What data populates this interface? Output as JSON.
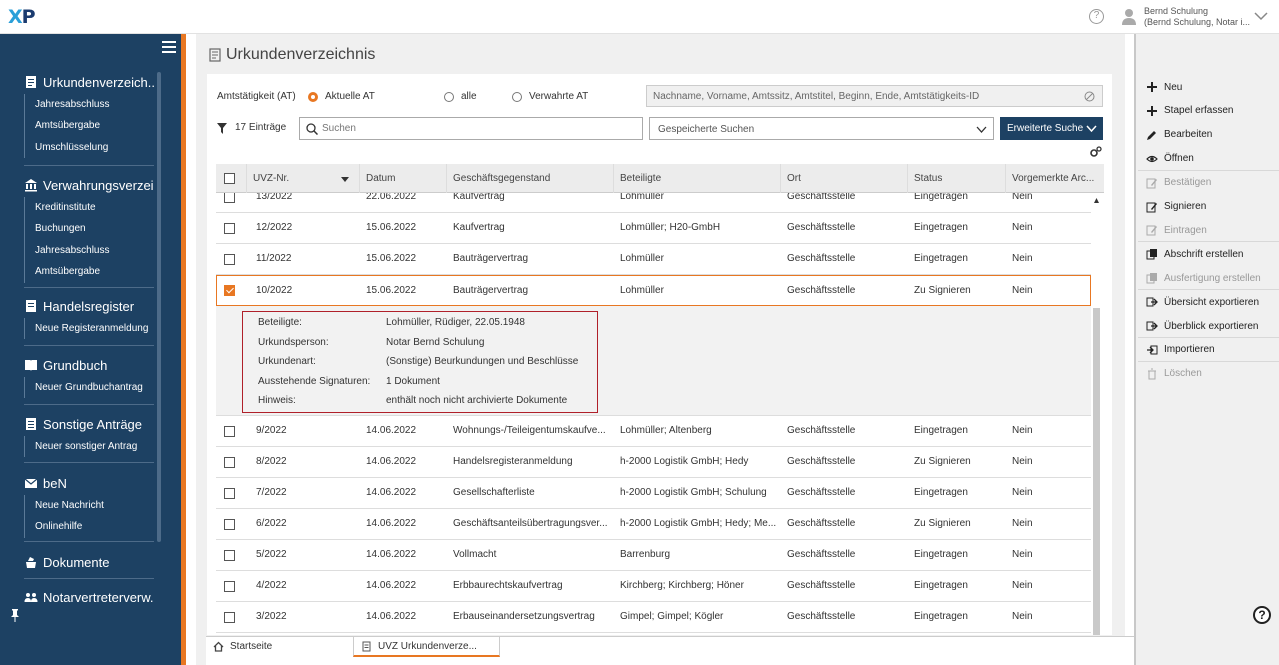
{
  "app": {
    "logo": "XP",
    "help_label": "?"
  },
  "user": {
    "name": "Bernd Schulung",
    "role": "(Bernd Schulung, Notar i..."
  },
  "sidebar": {
    "sections": [
      {
        "title": "Urkundenverzeich...",
        "icon": "document-icon",
        "items": [
          "Jahresabschluss",
          "Amtsübergabe",
          "Umschlüsselung"
        ]
      },
      {
        "title": "Verwahrungsverzei...",
        "icon": "bank-icon",
        "items": [
          "Kreditinstitute",
          "Buchungen",
          "Jahresabschluss",
          "Amtsübergabe"
        ]
      },
      {
        "title": "Handelsregister",
        "icon": "register-icon",
        "items": [
          "Neue Registeranmeldung"
        ]
      },
      {
        "title": "Grundbuch",
        "icon": "book-icon",
        "items": [
          "Neuer Grundbuchantrag"
        ]
      },
      {
        "title": "Sonstige Anträge",
        "icon": "list-icon",
        "items": [
          "Neuer sonstiger Antrag"
        ]
      },
      {
        "title": "beN",
        "icon": "envelope-icon",
        "items": [
          "Neue Nachricht",
          "Onlinehilfe"
        ]
      },
      {
        "title": "Dokumente",
        "icon": "documents-icon",
        "items": []
      },
      {
        "title": "Notarvertreterverw...",
        "icon": "people-icon",
        "items": []
      }
    ]
  },
  "page": {
    "title": "Urkundenverzeichnis",
    "at_label": "Amtstätigkeit (AT)",
    "at_options": [
      "Aktuelle AT",
      "alle",
      "Verwahrte AT"
    ],
    "at_selected": "Aktuelle AT",
    "at_search_placeholder": "Nachname, Vorname, Amtssitz, Amtstitel, Beginn, Ende, Amtstätigkeits-ID",
    "count": "17 Einträge",
    "search_placeholder": "Suchen",
    "saved_searches": "Gespeicherte Suchen",
    "advanced_search": "Erweiterte Suche"
  },
  "table": {
    "columns": [
      "UVZ-Nr.",
      "Datum",
      "Geschäftsgegenstand",
      "Beteiligte",
      "Ort",
      "Status",
      "Vorgemerkte Arc..."
    ],
    "rows": [
      {
        "nr": "13/2022",
        "datum": "22.06.2022",
        "gegenstand": "Kaufvertrag",
        "beteiligte": "Lohmüller",
        "ort": "Geschäftsstelle",
        "status": "Eingetragen",
        "arch": "Nein",
        "checked": false
      },
      {
        "nr": "12/2022",
        "datum": "15.06.2022",
        "gegenstand": "Kaufvertrag",
        "beteiligte": "Lohmüller; H20-GmbH",
        "ort": "Geschäftsstelle",
        "status": "Eingetragen",
        "arch": "Nein",
        "checked": false
      },
      {
        "nr": "11/2022",
        "datum": "15.06.2022",
        "gegenstand": "Bauträgervertrag",
        "beteiligte": "Lohmüller",
        "ort": "Geschäftsstelle",
        "status": "Eingetragen",
        "arch": "Nein",
        "checked": false
      },
      {
        "nr": "10/2022",
        "datum": "15.06.2022",
        "gegenstand": "Bauträgervertrag",
        "beteiligte": "Lohmüller",
        "ort": "Geschäftsstelle",
        "status": "Zu Signieren",
        "arch": "Nein",
        "checked": true
      },
      {
        "nr": "9/2022",
        "datum": "14.06.2022",
        "gegenstand": "Wohnungs-/Teileigentumskaufve...",
        "beteiligte": "Lohmüller; Altenberg",
        "ort": "Geschäftsstelle",
        "status": "Eingetragen",
        "arch": "Nein",
        "checked": false
      },
      {
        "nr": "8/2022",
        "datum": "14.06.2022",
        "gegenstand": "Handelsregisteranmeldung",
        "beteiligte": "h-2000 Logistik GmbH; Hedy",
        "ort": "Geschäftsstelle",
        "status": "Zu Signieren",
        "arch": "Nein",
        "checked": false
      },
      {
        "nr": "7/2022",
        "datum": "14.06.2022",
        "gegenstand": "Gesellschafterliste",
        "beteiligte": "h-2000 Logistik GmbH; Schulung",
        "ort": "Geschäftsstelle",
        "status": "Eingetragen",
        "arch": "Nein",
        "checked": false
      },
      {
        "nr": "6/2022",
        "datum": "14.06.2022",
        "gegenstand": "Geschäftsanteilsübertragungsver...",
        "beteiligte": "h-2000 Logistik GmbH; Hedy; Me...",
        "ort": "Geschäftsstelle",
        "status": "Zu Signieren",
        "arch": "Nein",
        "checked": false
      },
      {
        "nr": "5/2022",
        "datum": "14.06.2022",
        "gegenstand": "Vollmacht",
        "beteiligte": "Barrenburg",
        "ort": "Geschäftsstelle",
        "status": "Eingetragen",
        "arch": "Nein",
        "checked": false
      },
      {
        "nr": "4/2022",
        "datum": "14.06.2022",
        "gegenstand": "Erbbaurechtskaufvertrag",
        "beteiligte": "Kirchberg; Kirchberg; Höner",
        "ort": "Geschäftsstelle",
        "status": "Eingetragen",
        "arch": "Nein",
        "checked": false
      },
      {
        "nr": "3/2022",
        "datum": "14.06.2022",
        "gegenstand": "Erbauseinandersetzungsvertrag",
        "beteiligte": "Gimpel; Gimpel; Kögler",
        "ort": "Geschäftsstelle",
        "status": "Eingetragen",
        "arch": "Nein",
        "checked": false
      }
    ],
    "detail": [
      {
        "key": "Beteiligte:",
        "value": "Lohmüller, Rüdiger, 22.05.1948"
      },
      {
        "key": "Urkundsperson:",
        "value": "Notar Bernd Schulung"
      },
      {
        "key": "Urkundenart:",
        "value": "(Sonstige) Beurkundungen und Beschlüsse"
      },
      {
        "key": "Ausstehende Signaturen:",
        "value": "1 Dokument"
      },
      {
        "key": "Hinweis:",
        "value": "enthält noch nicht archivierte Dokumente"
      }
    ]
  },
  "actions": [
    {
      "label": "Neu",
      "icon": "plus-icon",
      "enabled": true
    },
    {
      "label": "Stapel erfassen",
      "icon": "plus-icon",
      "enabled": true
    },
    {
      "label": "Bearbeiten",
      "icon": "pencil-icon",
      "enabled": true
    },
    {
      "label": "Öffnen",
      "icon": "eye-icon",
      "enabled": true
    },
    {
      "label": "Bestätigen",
      "icon": "edit-icon",
      "enabled": false
    },
    {
      "label": "Signieren",
      "icon": "sign-icon",
      "enabled": true
    },
    {
      "label": "Eintragen",
      "icon": "enter-icon",
      "enabled": false
    },
    {
      "label": "Abschrift erstellen",
      "icon": "copy-icon",
      "enabled": true
    },
    {
      "label": "Ausfertigung erstellen",
      "icon": "copy-icon",
      "enabled": false
    },
    {
      "label": "Übersicht exportieren",
      "icon": "export-icon",
      "enabled": true
    },
    {
      "label": "Überblick exportieren",
      "icon": "export-icon",
      "enabled": true
    },
    {
      "label": "Importieren",
      "icon": "import-icon",
      "enabled": true
    },
    {
      "label": "Löschen",
      "icon": "trash-icon",
      "enabled": false
    }
  ],
  "tabs": [
    {
      "label": "Startseite",
      "icon": "home-icon"
    },
    {
      "label": "UVZ Urkundenverze...",
      "icon": "document-icon"
    }
  ],
  "colors": {
    "sidebar": "#1d4163",
    "accent": "#e87722",
    "highlight_border": "#b0202a"
  }
}
